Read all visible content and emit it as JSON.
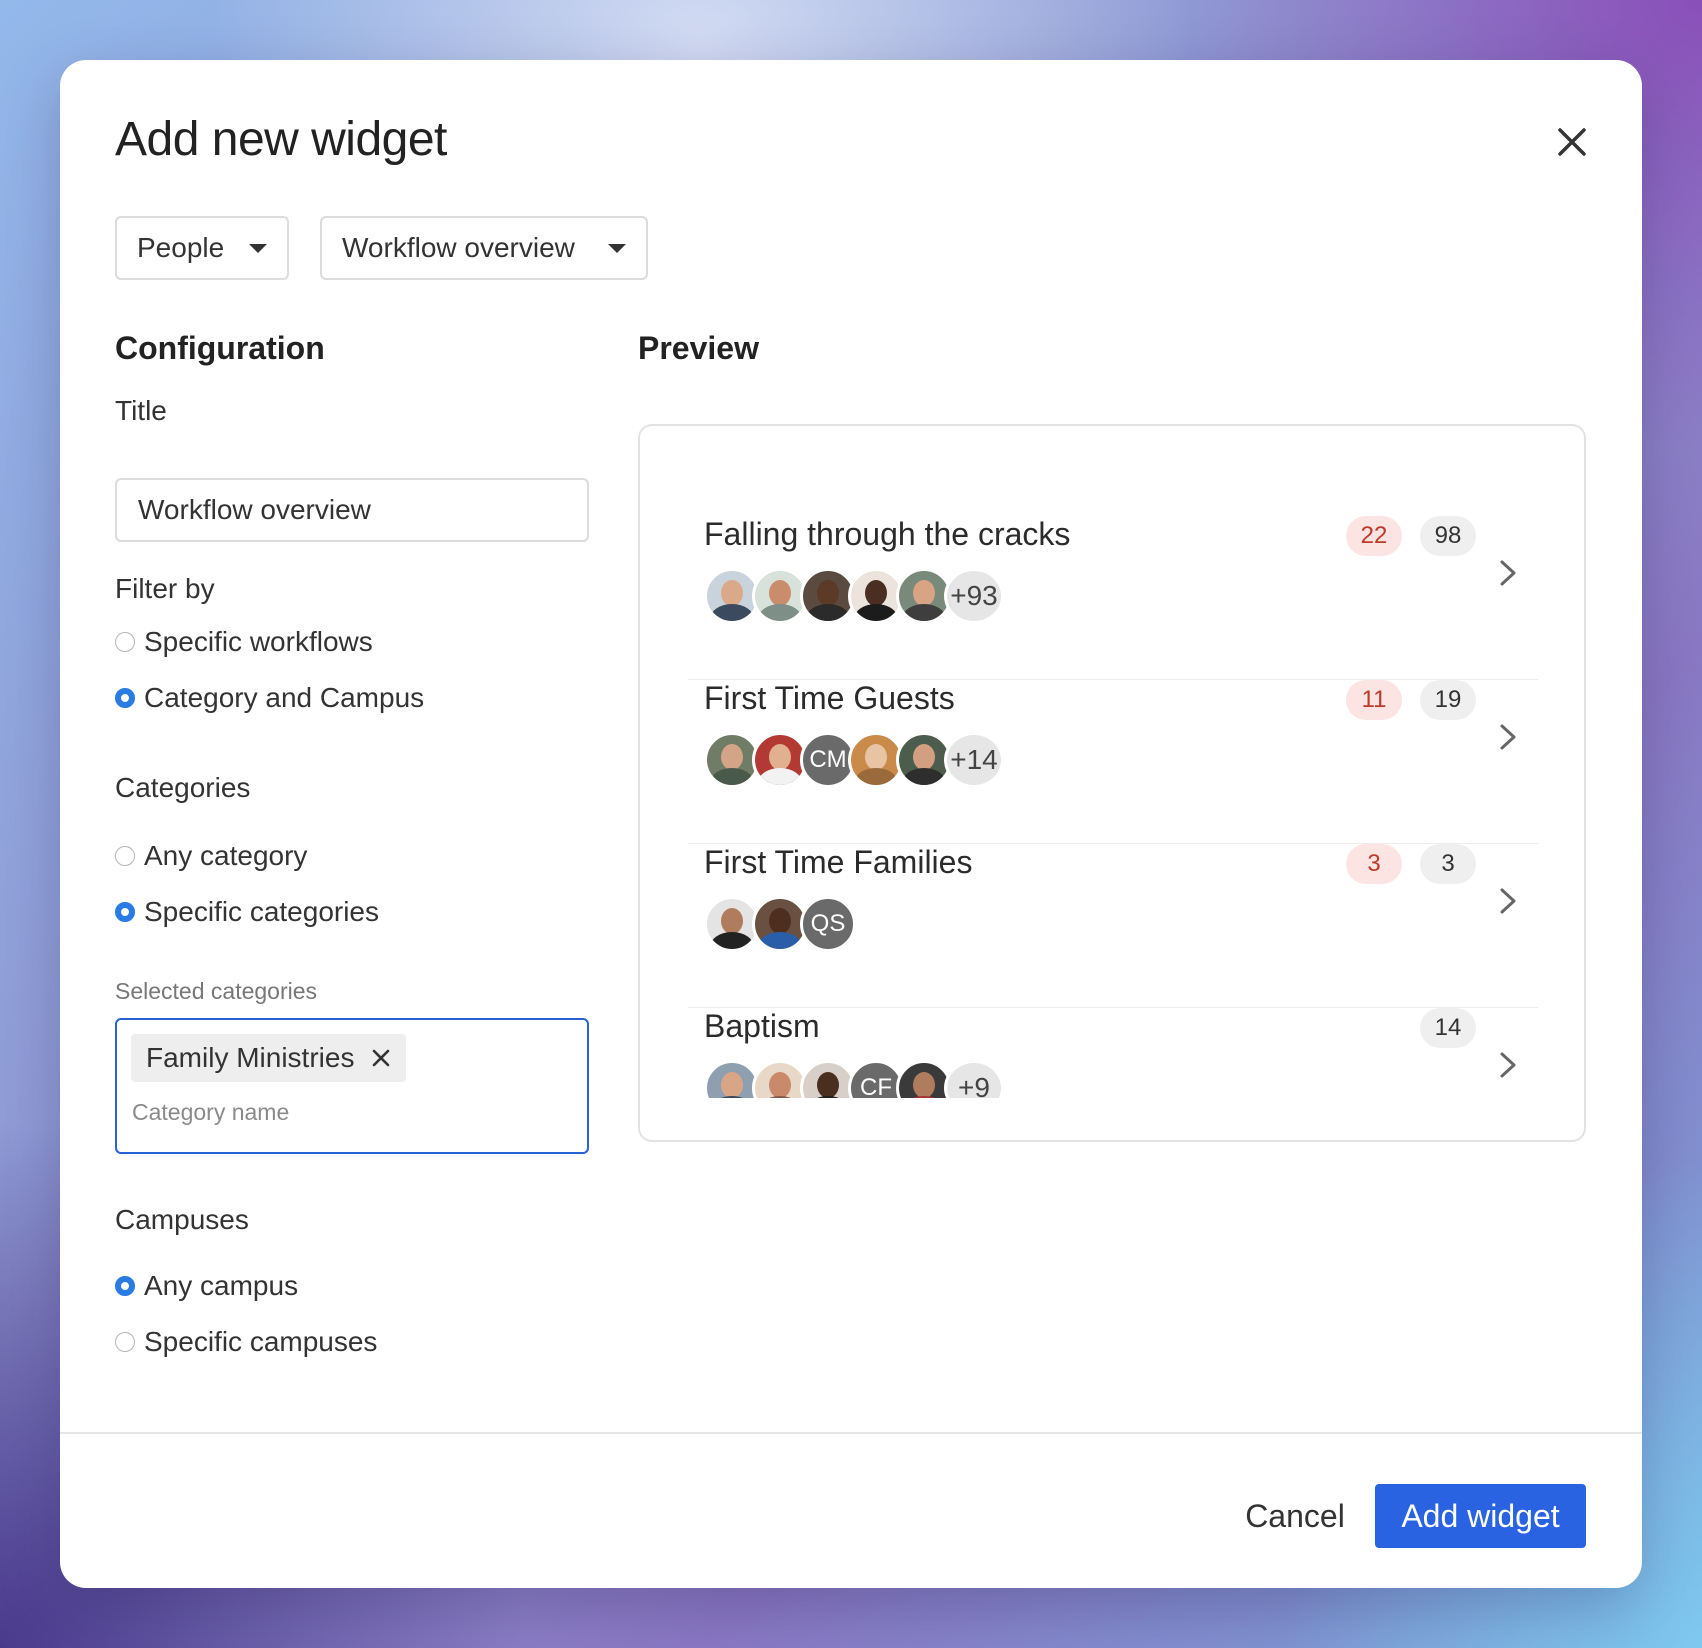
{
  "modal": {
    "title": "Add new widget",
    "dropdowns": {
      "source": "People",
      "widget_type": "Workflow overview"
    }
  },
  "configuration": {
    "heading": "Configuration",
    "title_label": "Title",
    "title_value": "Workflow overview",
    "filter_by": {
      "label": "Filter by",
      "options": [
        "Specific workflows",
        "Category and Campus"
      ],
      "selected": "Category and Campus"
    },
    "categories": {
      "label": "Categories",
      "options": [
        "Any category",
        "Specific categories"
      ],
      "selected": "Specific categories",
      "selected_label": "Selected categories",
      "tags": [
        "Family Ministries"
      ],
      "placeholder": "Category name"
    },
    "campuses": {
      "label": "Campuses",
      "options": [
        "Any campus",
        "Specific campuses"
      ],
      "selected": "Any campus"
    }
  },
  "preview": {
    "heading": "Preview",
    "workflows": [
      {
        "name": "Falling through the cracks",
        "overdue": "22",
        "total": "98",
        "avatars": [
          "photo",
          "photo",
          "photo",
          "photo",
          "photo"
        ],
        "more": "+93"
      },
      {
        "name": "First Time Guests",
        "overdue": "11",
        "total": "19",
        "avatars": [
          "photo",
          "photo",
          "CM",
          "photo",
          "photo"
        ],
        "more": "+14"
      },
      {
        "name": "First Time Families",
        "overdue": "3",
        "total": "3",
        "avatars": [
          "photo",
          "photo",
          "QS"
        ],
        "more": ""
      },
      {
        "name": "Baptism",
        "overdue": "",
        "total": "14",
        "avatars": [
          "photo",
          "photo",
          "photo",
          "CF",
          "photo"
        ],
        "more": "+9"
      }
    ]
  },
  "footer": {
    "cancel_label": "Cancel",
    "submit_label": "Add widget"
  },
  "colors": {
    "accent": "#2a63e2",
    "radio_on": "#2a7be4",
    "badge_red_bg": "#fbe4e1",
    "badge_red_text": "#c0392b"
  },
  "icons": {
    "close": "close-icon",
    "caret": "caret-down-icon",
    "chevron": "chevron-right-icon",
    "tag_remove": "remove-tag-icon"
  }
}
